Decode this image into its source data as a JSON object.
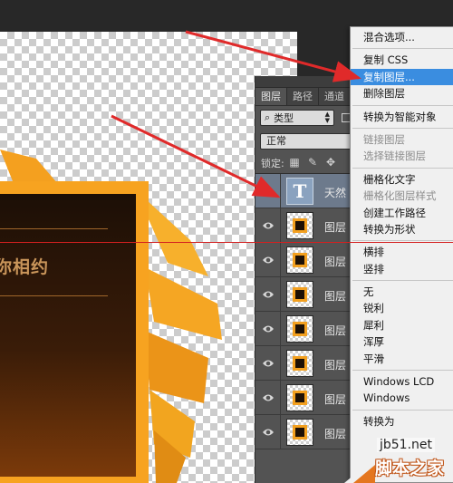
{
  "canvas": {
    "art_title": "你相约"
  },
  "layers_panel": {
    "tabs": [
      "图层",
      "路径",
      "通道"
    ],
    "filter": {
      "kind_label": "类型"
    },
    "blend_mode": "正常",
    "lock_label": "锁定:",
    "layers": [
      {
        "name": "天然",
        "type": "text",
        "selected": true
      },
      {
        "name": "图层",
        "type": "image",
        "selected": false
      },
      {
        "name": "图层",
        "type": "image",
        "selected": false
      },
      {
        "name": "图层",
        "type": "image",
        "selected": false
      },
      {
        "name": "图层",
        "type": "image",
        "selected": false
      },
      {
        "name": "图层",
        "type": "image",
        "selected": false
      },
      {
        "name": "图层",
        "type": "image",
        "selected": false
      },
      {
        "name": "图层",
        "type": "image",
        "selected": false
      }
    ]
  },
  "context_menu": {
    "groups": [
      [
        {
          "label": "混合选项...",
          "enabled": true
        }
      ],
      [
        {
          "label": "复制 CSS",
          "enabled": true
        },
        {
          "label": "复制图层...",
          "enabled": true,
          "hovered": true
        },
        {
          "label": "删除图层",
          "enabled": true
        }
      ],
      [
        {
          "label": "转换为智能对象",
          "enabled": true
        }
      ],
      [
        {
          "label": "链接图层",
          "enabled": false
        },
        {
          "label": "选择链接图层",
          "enabled": false
        }
      ],
      [
        {
          "label": "栅格化文字",
          "enabled": true
        },
        {
          "label": "栅格化图层样式",
          "enabled": false
        },
        {
          "label": "创建工作路径",
          "enabled": true
        },
        {
          "label": "转换为形状",
          "enabled": true
        }
      ],
      [
        {
          "label": "横排",
          "enabled": true
        },
        {
          "label": "竖排",
          "enabled": true
        }
      ],
      [
        {
          "label": "无",
          "enabled": true
        },
        {
          "label": "锐利",
          "enabled": true
        },
        {
          "label": "犀利",
          "enabled": true
        },
        {
          "label": "浑厚",
          "enabled": true
        },
        {
          "label": "平滑",
          "enabled": true
        }
      ],
      [
        {
          "label": "Windows LCD",
          "enabled": true
        },
        {
          "label": "Windows",
          "enabled": true
        }
      ],
      [
        {
          "label": "转换为",
          "enabled": true
        }
      ]
    ]
  },
  "watermark": {
    "site": "jb51.net",
    "name": "脚本之家"
  },
  "colors": {
    "accent_orange": "#f7a320",
    "arrow_red": "#e02a2a",
    "menu_highlight": "#3a8de0",
    "selected_layer": "#6d7a8c"
  }
}
